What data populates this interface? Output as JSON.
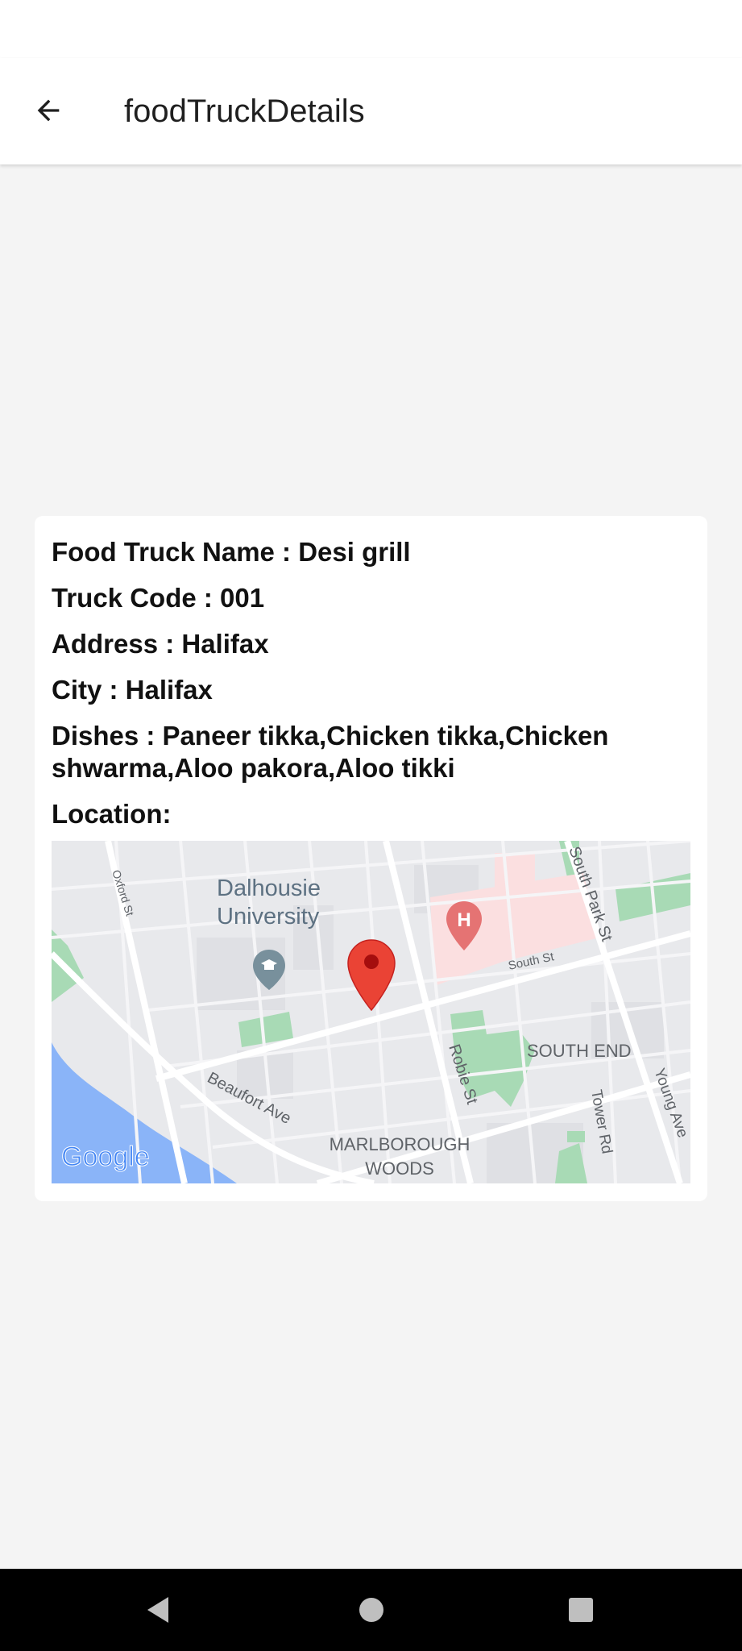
{
  "app_bar": {
    "title": "foodTruckDetails",
    "back_icon": "arrow-left-icon"
  },
  "details": {
    "name_line": "Food Truck Name : Desi grill",
    "code_line": "Truck Code : 001",
    "address_line": "Address : Halifax",
    "city_line": "City : Halifax",
    "dishes_line": "Dishes : Paneer tikka,Chicken tikka,Chicken shwarma,Aloo pakora,Aloo tikki",
    "location_label": "Location:"
  },
  "map": {
    "labels": {
      "university_line1": "Dalhousie",
      "university_line2": "University",
      "oxford_st": "Oxford St",
      "south_park_st": "South Park St",
      "south_st": "South St",
      "south_end": "SOUTH END",
      "robie_st": "Robie St",
      "tower_rd": "Tower Rd",
      "young_ave": "Young Ave",
      "beaufort_ave": "Beaufort Ave",
      "marlborough_line1": "MARLBOROUGH",
      "marlborough_line2": "WOODS",
      "hospital_letter": "H",
      "google_logo": "Google"
    },
    "colors": {
      "land": "#e8e9ec",
      "road": "#ffffff",
      "park": "#a8dab5",
      "water": "#8ab4f8",
      "hospital_area": "#fbdfe0",
      "marker": "#ea4335"
    }
  },
  "nav_bar": {
    "back_icon": "triangle-back-icon",
    "home_icon": "circle-home-icon",
    "recents_icon": "square-recents-icon"
  }
}
